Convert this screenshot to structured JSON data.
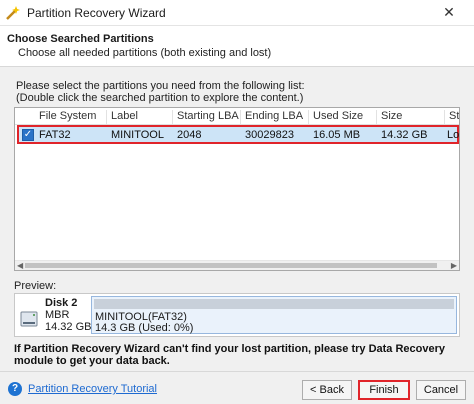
{
  "window": {
    "title": "Partition Recovery Wizard",
    "close_glyph": "✕"
  },
  "header": {
    "title": "Choose Searched Partitions",
    "subtitle": "Choose all needed partitions (both existing and lost)"
  },
  "instructions": {
    "line1": "Please select the partitions you need from the following list:",
    "line2": "(Double click the searched partition to explore the content.)"
  },
  "table": {
    "columns": [
      "File System",
      "Label",
      "Starting LBA",
      "Ending LBA",
      "Used Size",
      "Size",
      "Stat"
    ],
    "rows": [
      {
        "checked": true,
        "file_system": "FAT32",
        "label": "MINITOOL",
        "starting_lba": "2048",
        "ending_lba": "30029823",
        "used_size": "16.05 MB",
        "size": "14.32 GB",
        "status": "Los"
      }
    ]
  },
  "preview": {
    "label": "Preview:",
    "disk": {
      "name": "Disk 2",
      "type": "MBR",
      "size": "14.32 GB"
    },
    "partition": {
      "name": "MINITOOL(FAT32)",
      "size": "14.3 GB (Used: 0%)",
      "used_fraction": 0.0
    }
  },
  "note": "If Partition Recovery Wizard can't find your lost partition, please try Data Recovery module to get your data back.",
  "footer": {
    "help_link": "Partition Recovery Tutorial",
    "back": "< Back",
    "finish": "Finish",
    "cancel": "Cancel"
  },
  "colors": {
    "highlight": "#e0242a",
    "selection": "#cde4f7",
    "link": "#1e6ad1",
    "accent": "#2a73c8"
  }
}
